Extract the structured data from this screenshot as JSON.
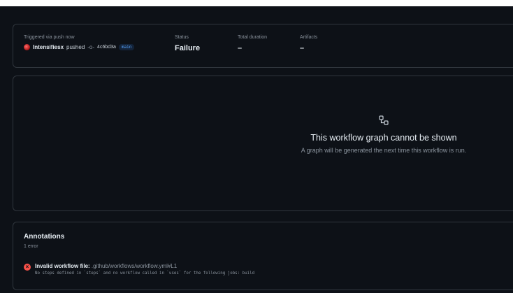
{
  "summary": {
    "trigger_label": "Triggered via push now",
    "actor": "Intensifiesx",
    "action": "pushed",
    "commit_sha": "4c6bd3a",
    "branch": "main",
    "status_label": "Status",
    "status_value": "Failure",
    "duration_label": "Total duration",
    "duration_value": "–",
    "artifacts_label": "Artifacts",
    "artifacts_value": "–"
  },
  "graph": {
    "icon": "workflow-icon",
    "title": "This workflow graph cannot be shown",
    "subtitle": "A graph will be generated the next time this workflow is run."
  },
  "annotations": {
    "title": "Annotations",
    "count": "1 error",
    "items": [
      {
        "icon": "x-circle-icon",
        "heading": "Invalid workflow file:",
        "path": ".github/workflows/workflow.yml#L1",
        "detail": "No steps defined in `steps` and no workflow called in `uses` for the following jobs: build"
      }
    ]
  },
  "colors": {
    "background": "#0d1117",
    "border": "#30363d",
    "error": "#f85149",
    "branch_link": "#58a6ff"
  }
}
